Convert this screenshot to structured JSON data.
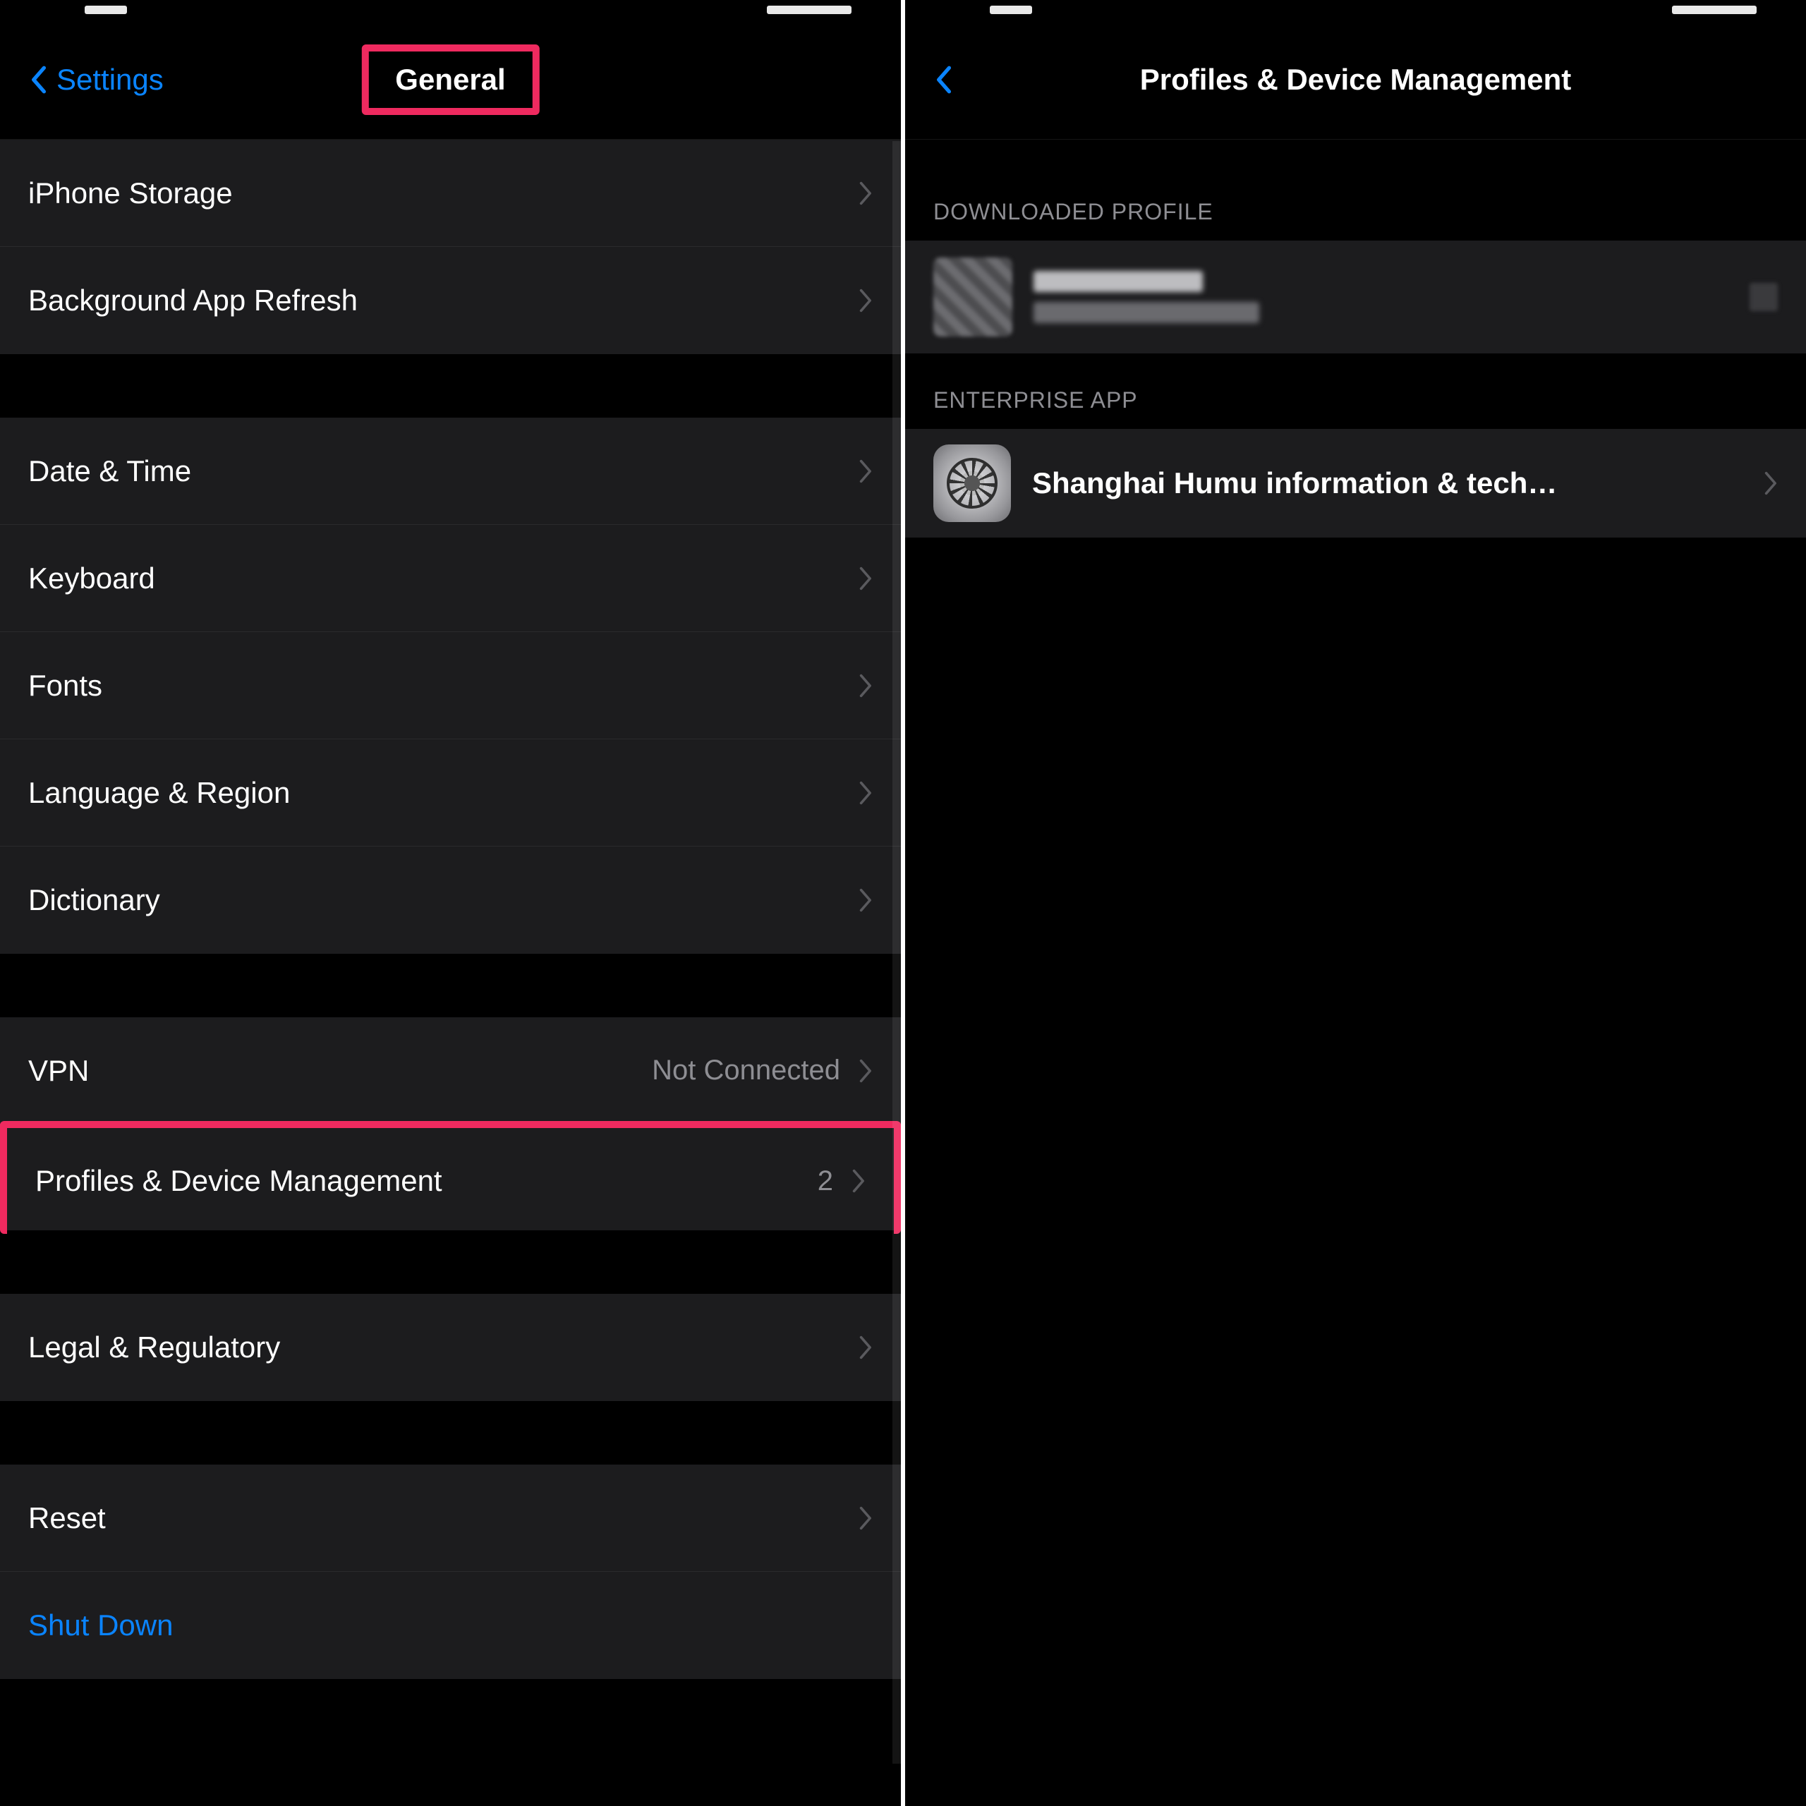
{
  "left": {
    "back_label": "Settings",
    "title": "General",
    "group1": [
      {
        "label": "iPhone Storage"
      },
      {
        "label": "Background App Refresh"
      }
    ],
    "group2": [
      {
        "label": "Date & Time"
      },
      {
        "label": "Keyboard"
      },
      {
        "label": "Fonts"
      },
      {
        "label": "Language & Region"
      },
      {
        "label": "Dictionary"
      }
    ],
    "group3": [
      {
        "label": "VPN",
        "detail": "Not Connected"
      },
      {
        "label": "Profiles & Device Management",
        "detail": "2",
        "highlight": true
      }
    ],
    "group4": [
      {
        "label": "Legal & Regulatory"
      }
    ],
    "group5": [
      {
        "label": "Reset"
      },
      {
        "label": "Shut Down",
        "link": true,
        "no_chevron": true
      }
    ]
  },
  "right": {
    "title": "Profiles & Device Management",
    "section1_header": "DOWNLOADED PROFILE",
    "section2_header": "ENTERPRISE APP",
    "enterprise_app_label": "Shanghai Humu information & tech…"
  }
}
